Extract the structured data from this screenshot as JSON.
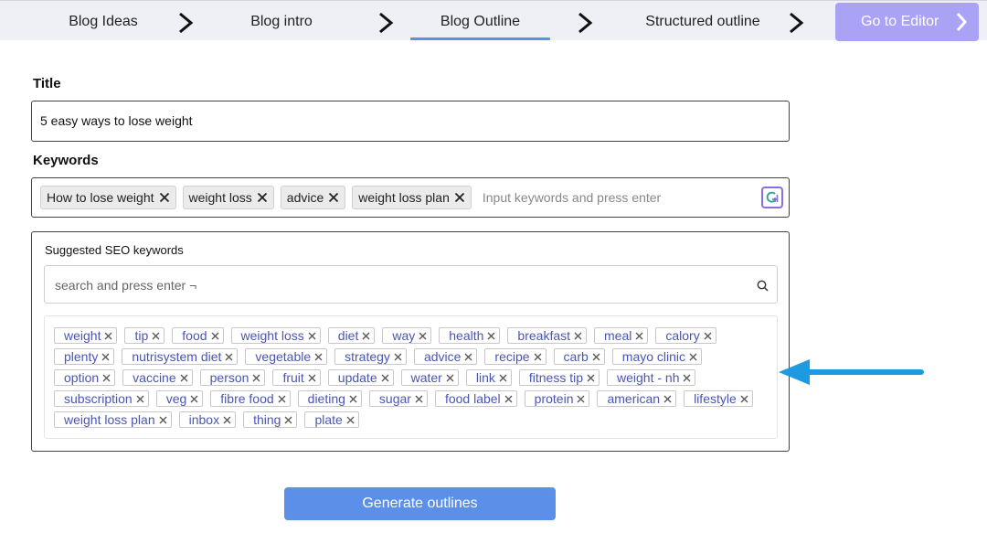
{
  "stepper": {
    "steps": [
      {
        "label": "Blog Ideas"
      },
      {
        "label": "Blog intro"
      },
      {
        "label": "Blog Outline"
      },
      {
        "label": "Structured outline"
      }
    ],
    "editor_button": "Go to Editor"
  },
  "title_field": {
    "label": "Title",
    "value": "5 easy ways to lose weight"
  },
  "keywords_field": {
    "label": "Keywords",
    "chips": [
      "How to lose weight",
      "weight loss",
      "advice",
      "weight loss plan"
    ],
    "placeholder": "Input keywords and press enter"
  },
  "seo": {
    "title": "Suggested SEO keywords",
    "search_placeholder": "search and press enter ¬",
    "rows": [
      [
        "weight",
        "tip",
        "food",
        "weight loss",
        "diet",
        "way",
        "health",
        "breakfast",
        "meal",
        "calory"
      ],
      [
        "plenty",
        "nutrisystem diet",
        "vegetable",
        "strategy",
        "advice",
        "recipe",
        "carb",
        "mayo clinic"
      ],
      [
        "option",
        "vaccine",
        "person",
        "fruit",
        "update",
        "water",
        "link",
        "fitness tip",
        "weight - nh"
      ],
      [
        "subscription",
        "veg",
        "fibre food",
        "dieting",
        "sugar",
        "food label",
        "protein",
        "american",
        "lifestyle"
      ],
      [
        "weight loss plan",
        "inbox",
        "thing",
        "plate"
      ]
    ]
  },
  "generate_button": "Generate outlines",
  "colors": {
    "accent": "#5b8fe8",
    "editor_button": "#aaa2f5",
    "tag_text": "#4a55b8",
    "annotation_arrow": "#1e9be0"
  }
}
